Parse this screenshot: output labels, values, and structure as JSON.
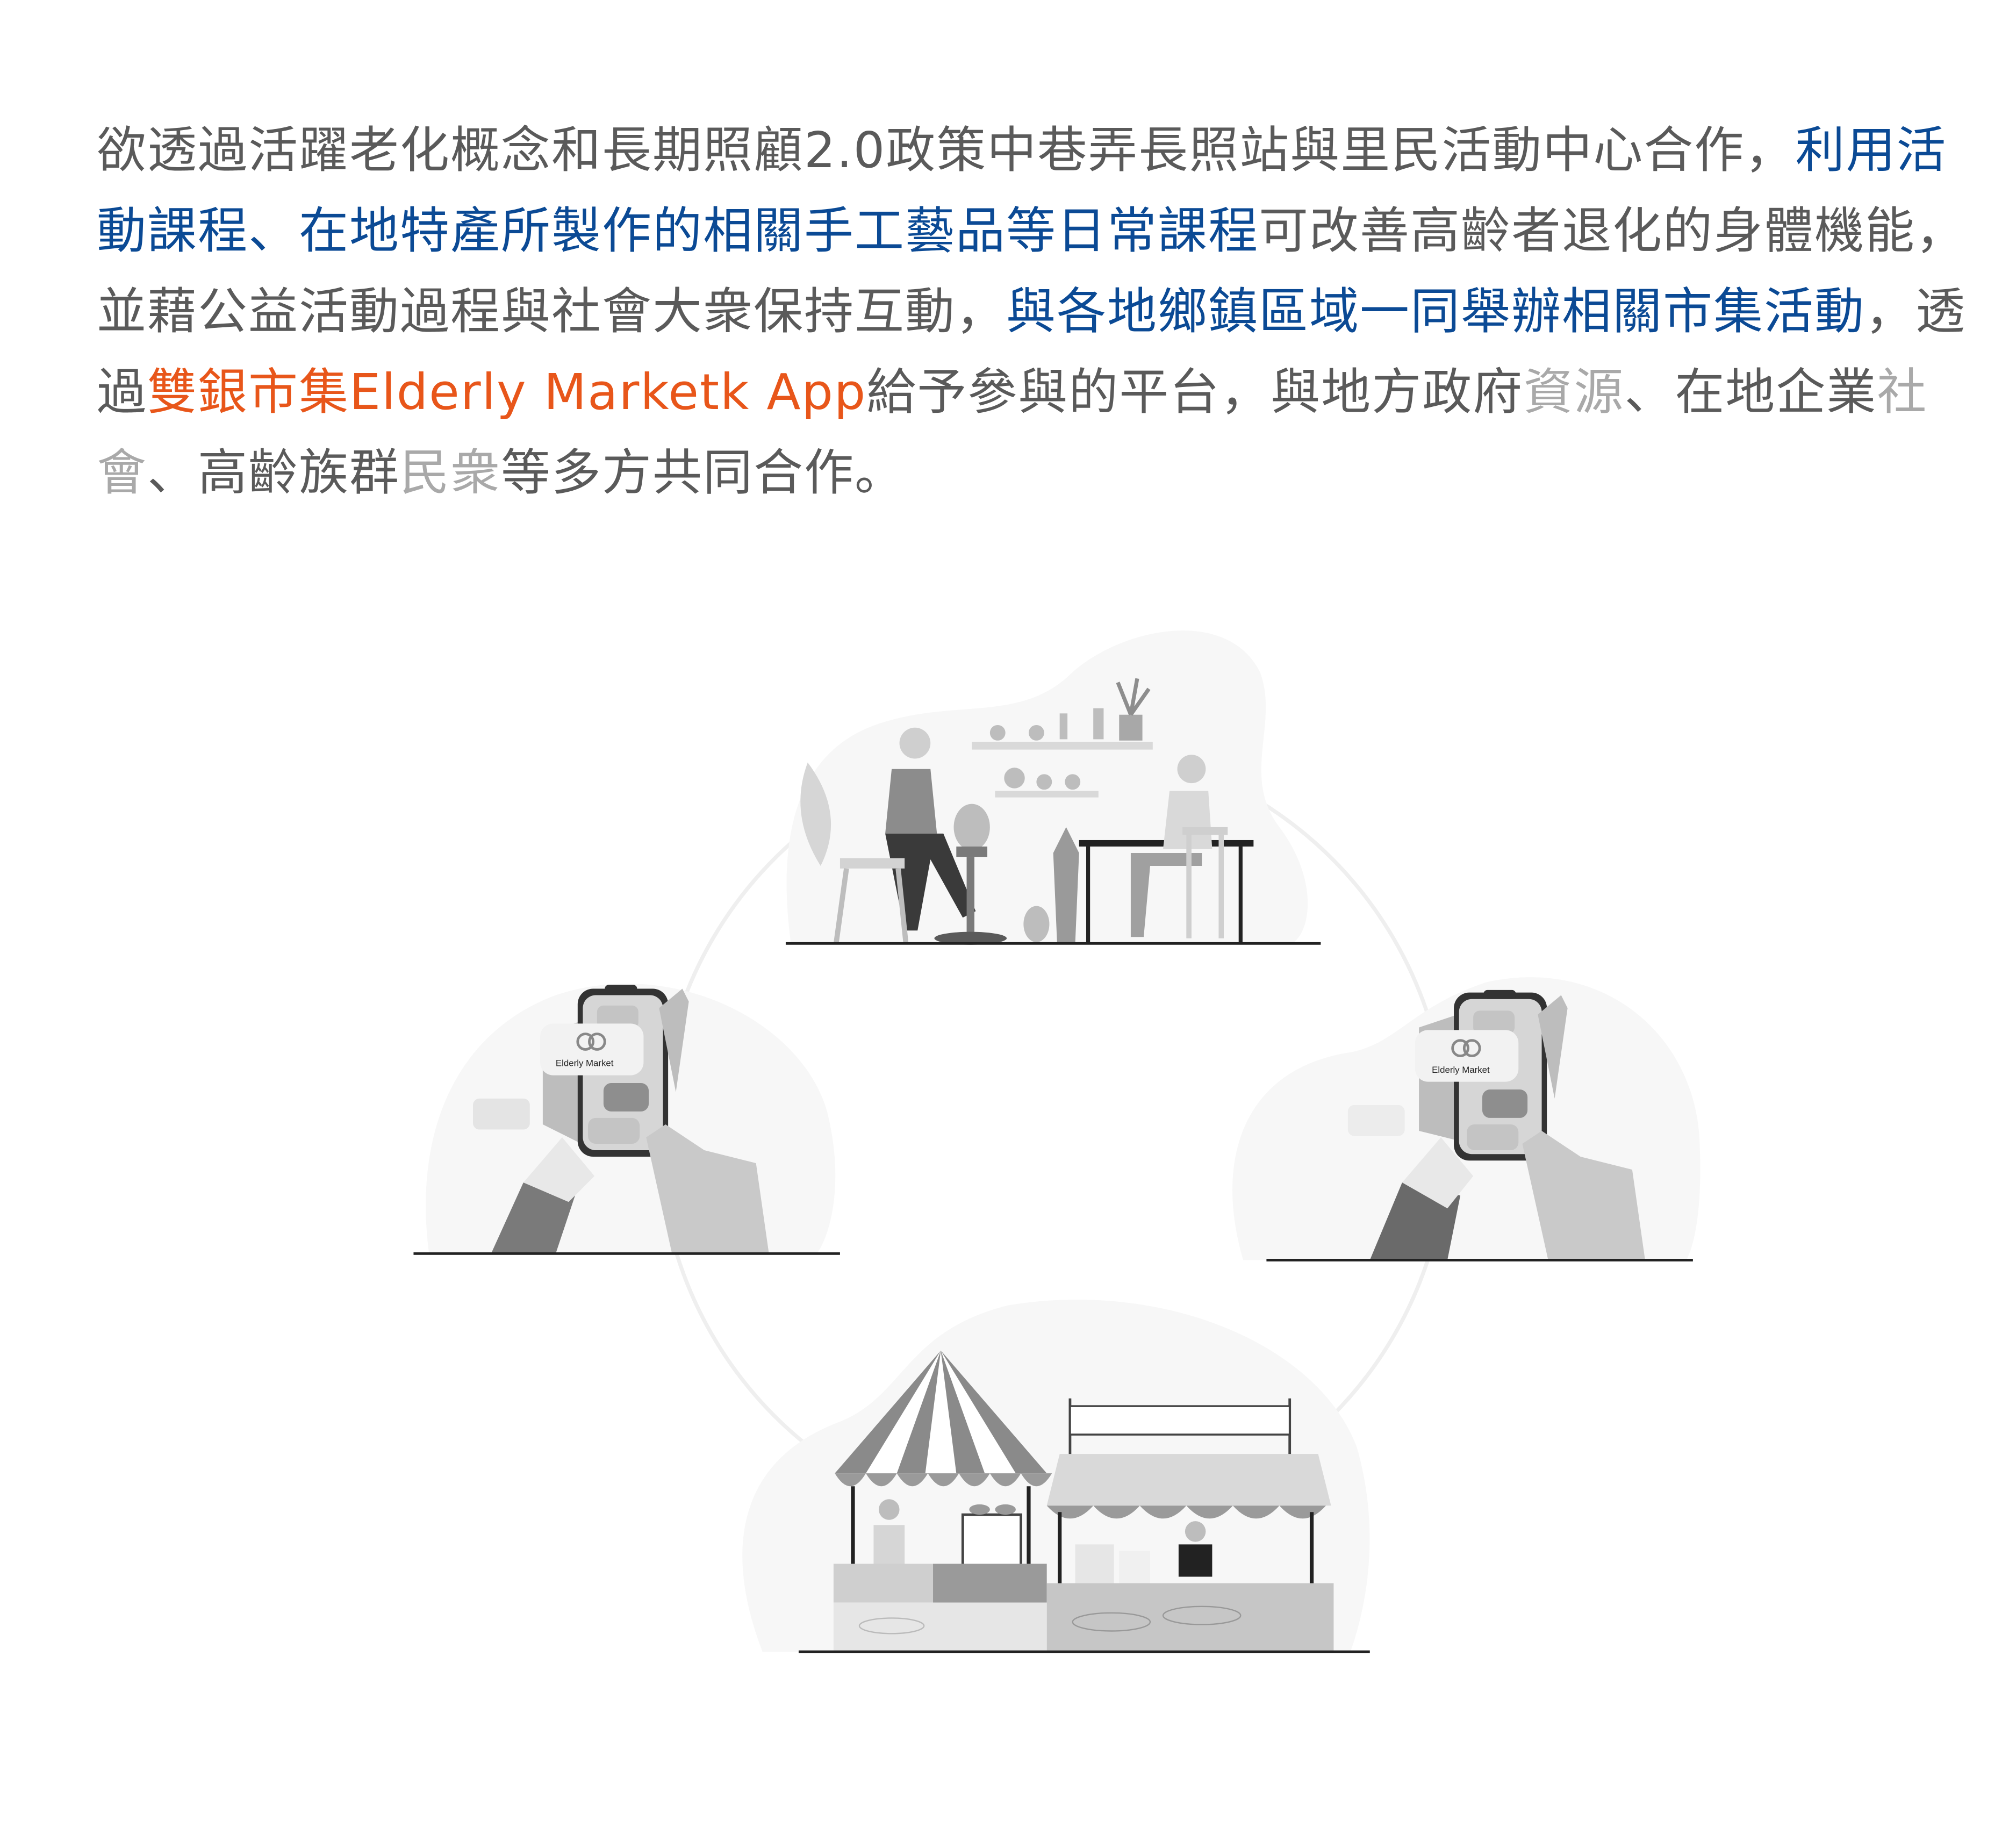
{
  "paragraph": {
    "segments": [
      {
        "text": "欲透過活躍老化概念和長期照顧2.0政策中巷弄長照站與里民活動中心合作，",
        "tone": "gray"
      },
      {
        "text": "利用活動課程、在地特產所製作的相關手工藝品等日常課程",
        "tone": "blue"
      },
      {
        "text": "可改善高齡者退化的身體機能，並藉公益活動過程與社會大衆保持互動，",
        "tone": "gray"
      },
      {
        "text": "與各地鄉鎮區域一同舉辦相關市集活動",
        "tone": "blue"
      },
      {
        "text": "，透過",
        "tone": "gray"
      },
      {
        "text": "雙銀市集Elderly Marketk App",
        "tone": "orange"
      },
      {
        "text": "給予參與的平台，與地方政府",
        "tone": "gray"
      },
      {
        "text": "資源",
        "tone": "light"
      },
      {
        "text": "、在地企業",
        "tone": "gray"
      },
      {
        "text": "社會",
        "tone": "light"
      },
      {
        "text": "、高齡族群",
        "tone": "gray"
      },
      {
        "text": "民衆",
        "tone": "light"
      },
      {
        "text": "等多方共同合作。",
        "tone": "gray"
      }
    ]
  },
  "illustrations": {
    "app_brand_left": "Elderly Market",
    "app_brand_right": "Elderly Market"
  },
  "colors": {
    "text": "#5a5a5a",
    "highlight_blue": "#0b4a95",
    "highlight_orange": "#e8561a",
    "muted": "#a9a9a9"
  }
}
